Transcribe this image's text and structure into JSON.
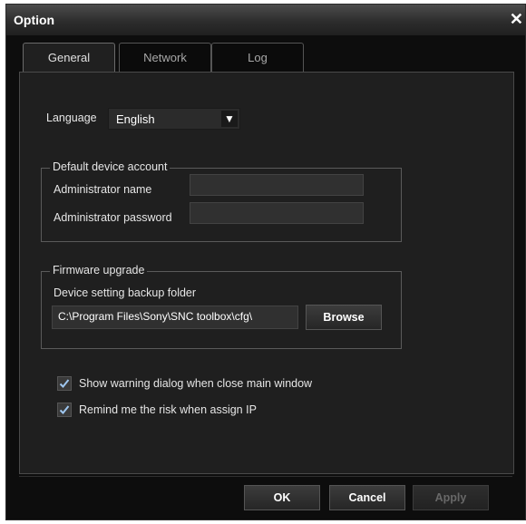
{
  "window": {
    "title": "Option",
    "close_glyph": "✕"
  },
  "tabs": [
    {
      "label": "General",
      "active": true
    },
    {
      "label": "Network",
      "active": false
    },
    {
      "label": "Log",
      "active": false
    }
  ],
  "general": {
    "language_label": "Language",
    "language_value": "English",
    "default_account": {
      "legend": "Default device account",
      "admin_name_label": "Administrator name",
      "admin_name_value": "",
      "admin_password_label": "Administrator password",
      "admin_password_value": ""
    },
    "firmware": {
      "legend": "Firmware upgrade",
      "backup_folder_label": "Device setting backup folder",
      "backup_folder_value": "C:\\Program Files\\Sony\\SNC toolbox\\cfg\\",
      "browse_label": "Browse"
    },
    "checkboxes": [
      {
        "label": "Show warning dialog when close main window",
        "checked": true
      },
      {
        "label": "Remind me the risk when assign IP",
        "checked": true
      }
    ]
  },
  "footer": {
    "ok_label": "OK",
    "cancel_label": "Cancel",
    "apply_label": "Apply",
    "apply_enabled": false
  },
  "colors": {
    "check_mark": "#9fc7f0",
    "background": "#0d0d0d",
    "panel": "#1f1f1f"
  }
}
